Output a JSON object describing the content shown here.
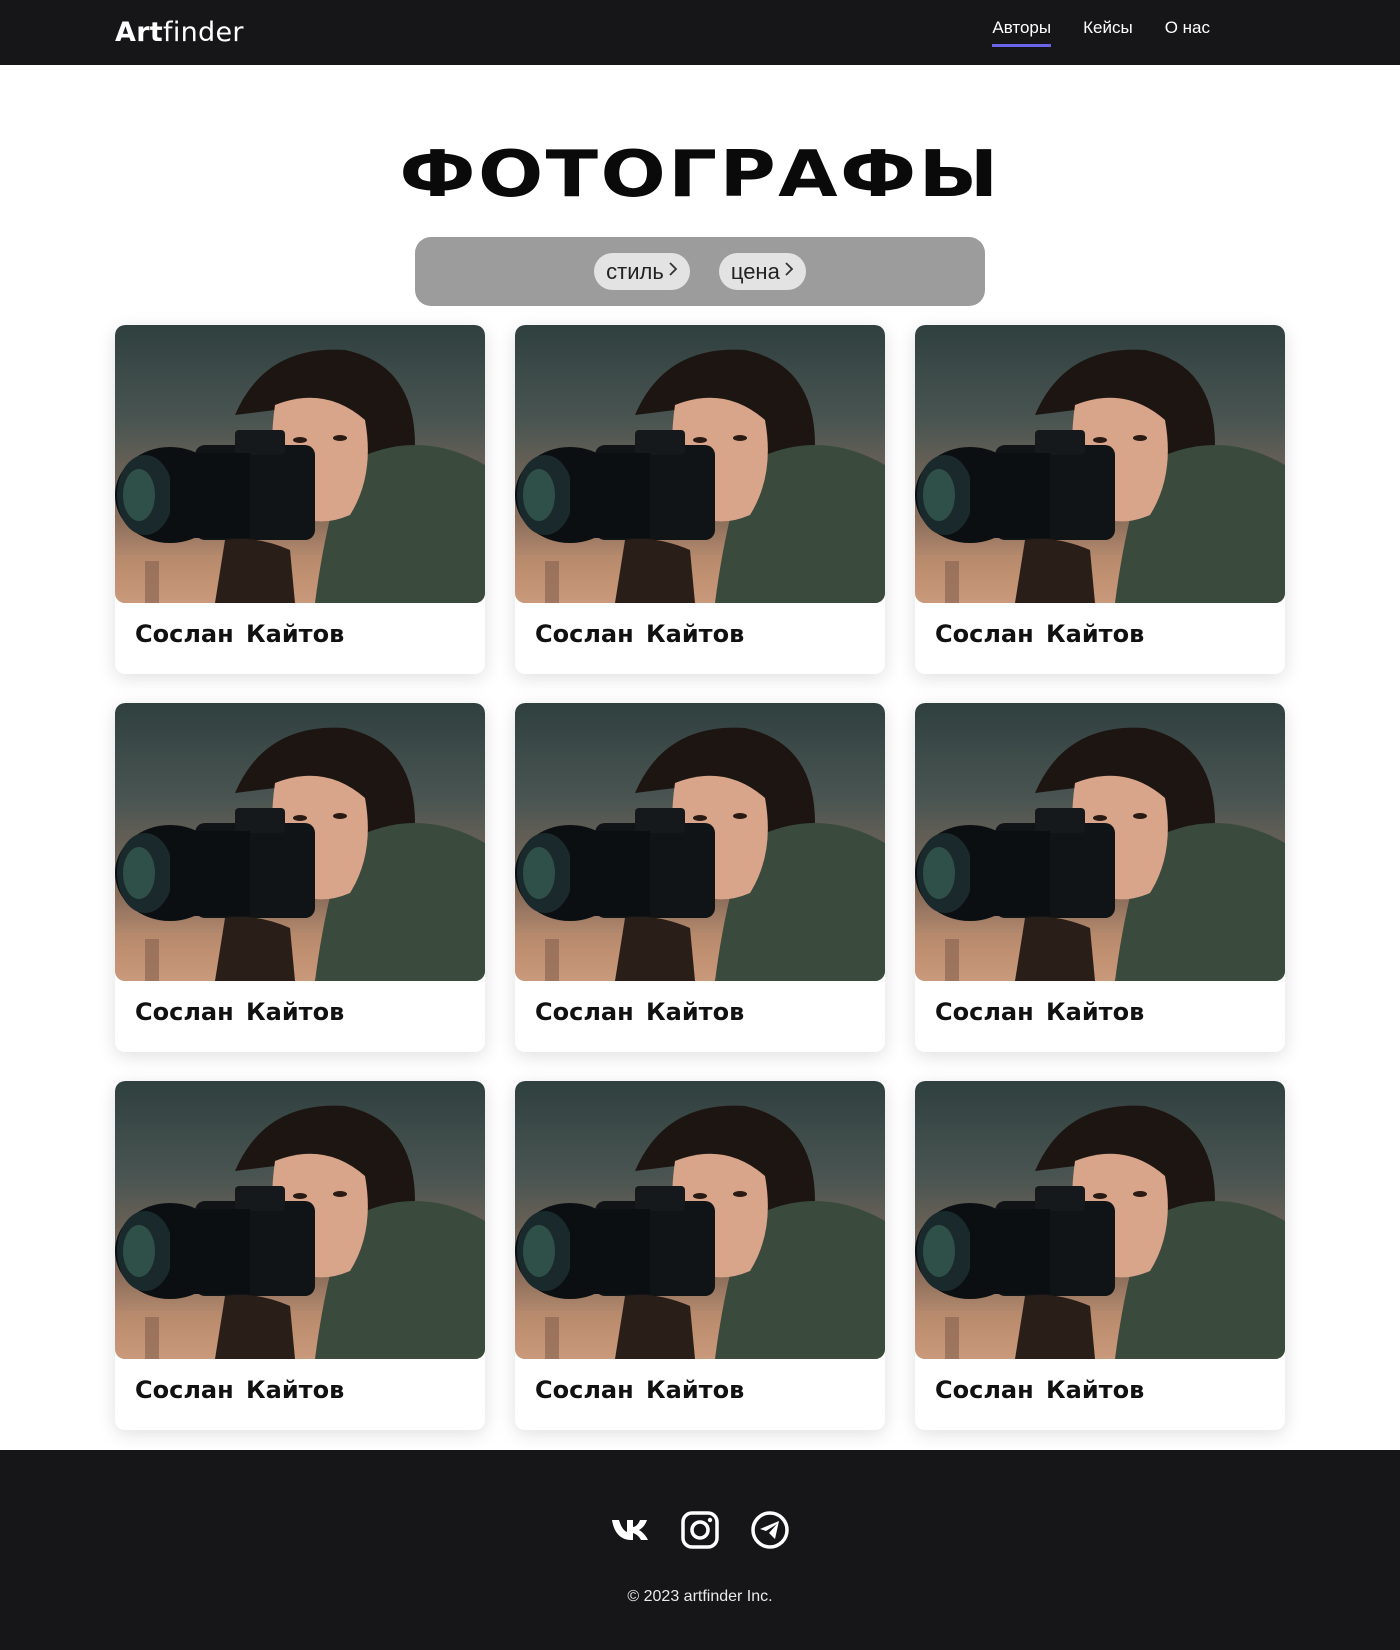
{
  "header": {
    "logo_bold": "Art",
    "logo_regular": "finder",
    "nav": [
      {
        "label": "Авторы",
        "active": true
      },
      {
        "label": "Кейсы",
        "active": false
      },
      {
        "label": "О нас",
        "active": false
      }
    ]
  },
  "main": {
    "title": "ФОТОГРАФЫ",
    "filters": [
      {
        "label": "стиль",
        "icon": "chevron-right-icon"
      },
      {
        "label": "цена",
        "icon": "chevron-right-icon"
      }
    ],
    "cards": [
      {
        "name": "Сослан Кайтов"
      },
      {
        "name": "Сослан Кайтов"
      },
      {
        "name": "Сослан Кайтов"
      },
      {
        "name": "Сослан Кайтов"
      },
      {
        "name": "Сослан Кайтов"
      },
      {
        "name": "Сослан Кайтов"
      },
      {
        "name": "Сослан Кайтов"
      },
      {
        "name": "Сослан Кайтов"
      },
      {
        "name": "Сослан Кайтов"
      }
    ]
  },
  "footer": {
    "socials": [
      "vk-icon",
      "instagram-icon",
      "telegram-icon"
    ],
    "copyright": "© 2023 artfinder Inc."
  },
  "colors": {
    "header_bg": "#161618",
    "accent": "#6b63e8",
    "filter_bar_bg": "#9c9c9c",
    "chip_bg": "#e3e3e3"
  }
}
